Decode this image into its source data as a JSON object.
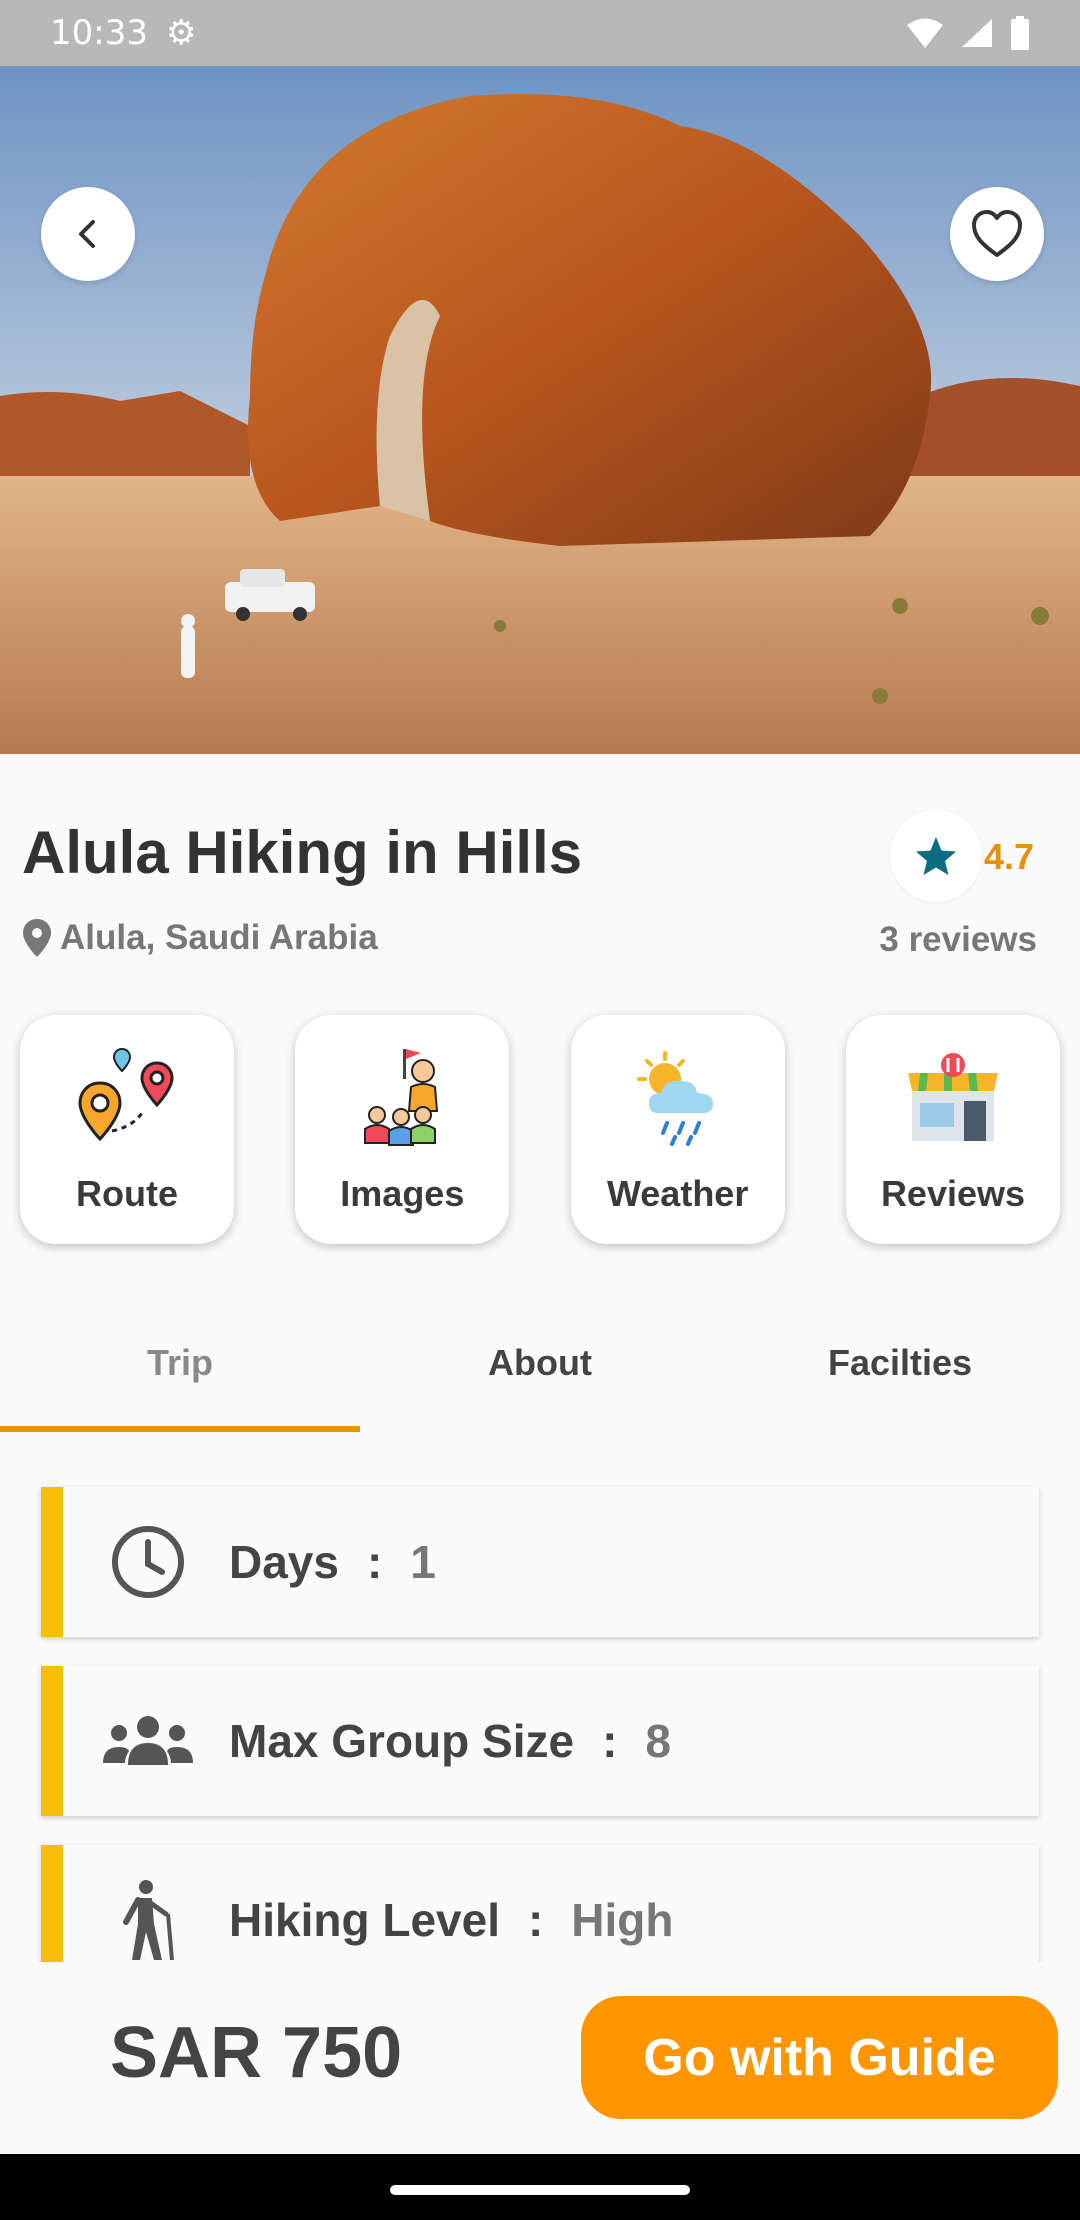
{
  "status_bar": {
    "time": "10:33"
  },
  "trip": {
    "title": "Alula Hiking in Hills",
    "location": "Alula, Saudi Arabia",
    "rating": "4.7",
    "reviews_count": "3 reviews"
  },
  "quick_actions": [
    {
      "label": "Route",
      "icon": "route-pins-icon"
    },
    {
      "label": "Images",
      "icon": "guide-group-icon"
    },
    {
      "label": "Weather",
      "icon": "weather-icon"
    },
    {
      "label": "Reviews",
      "icon": "storefront-icon"
    }
  ],
  "tabs": [
    {
      "label": "Trip",
      "active": true
    },
    {
      "label": "About",
      "active": false
    },
    {
      "label": "Facilties",
      "active": false
    }
  ],
  "details": [
    {
      "label": "Days",
      "separator": ":",
      "value": "1",
      "icon": "clock-icon"
    },
    {
      "label": "Max Group Size",
      "separator": ":",
      "value": "8",
      "icon": "group-icon"
    },
    {
      "label": "Hiking Level",
      "separator": ":",
      "value": "High",
      "icon": "hiker-icon"
    }
  ],
  "footer": {
    "price": "SAR 750",
    "cta_label": "Go with Guide"
  },
  "colors": {
    "accent": "#ff9500",
    "indicator": "#f39200",
    "row_bar": "#f7bd07",
    "rating_star": "#0b6b80",
    "rating_text": "#e8900c"
  }
}
